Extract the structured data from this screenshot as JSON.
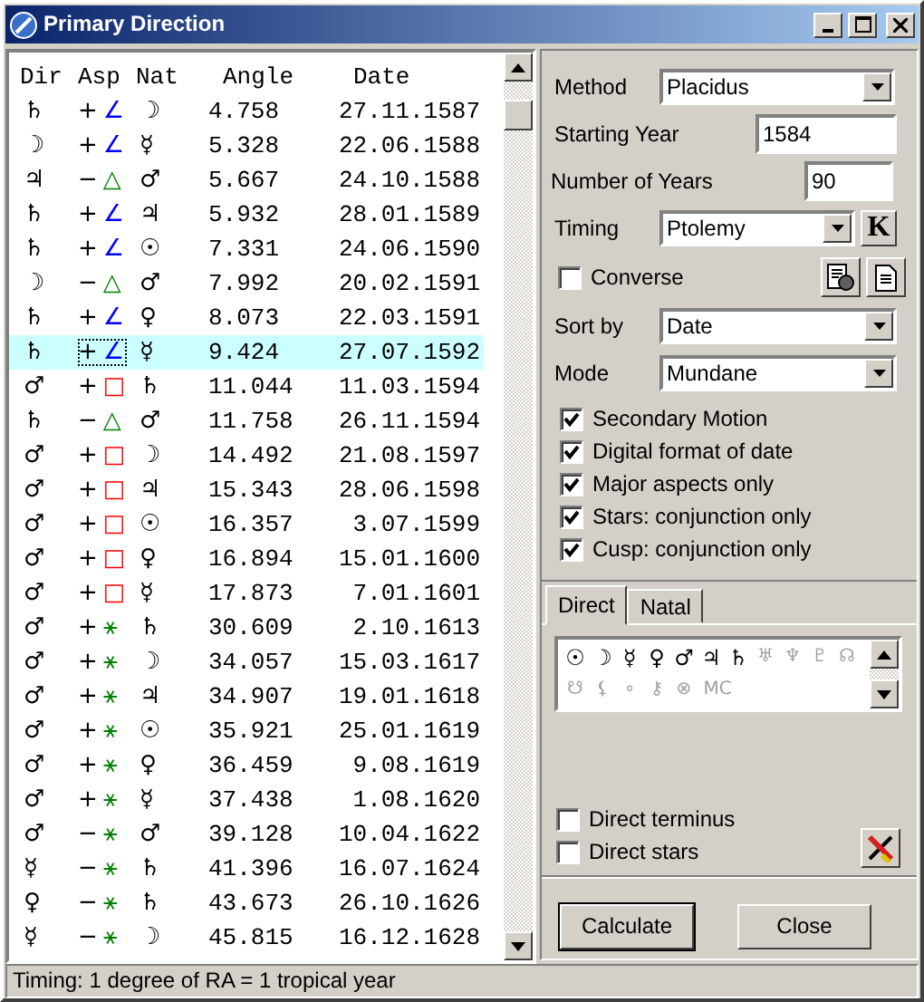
{
  "window": {
    "title": "Primary Direction"
  },
  "table": {
    "columns": [
      "Dir",
      "Asp",
      "Nat",
      "Angle",
      "Date"
    ],
    "rows": [
      {
        "dir": "♄",
        "sign": "+",
        "aspect": {
          "symbol": "∠",
          "color": "#0000ff"
        },
        "nat": "☽",
        "angle": "4.758",
        "date": "27.11.1587",
        "selected": false
      },
      {
        "dir": "☽",
        "sign": "+",
        "aspect": {
          "symbol": "∠",
          "color": "#0000ff"
        },
        "nat": "☿",
        "angle": "5.328",
        "date": "22.06.1588",
        "selected": false
      },
      {
        "dir": "♃",
        "sign": "−",
        "aspect": {
          "symbol": "△",
          "color": "#008000"
        },
        "nat": "♂",
        "angle": "5.667",
        "date": "24.10.1588",
        "selected": false
      },
      {
        "dir": "♄",
        "sign": "+",
        "aspect": {
          "symbol": "∠",
          "color": "#0000ff"
        },
        "nat": "♃",
        "angle": "5.932",
        "date": "28.01.1589",
        "selected": false
      },
      {
        "dir": "♄",
        "sign": "+",
        "aspect": {
          "symbol": "∠",
          "color": "#0000ff"
        },
        "nat": "☉",
        "angle": "7.331",
        "date": "24.06.1590",
        "selected": false
      },
      {
        "dir": "☽",
        "sign": "−",
        "aspect": {
          "symbol": "△",
          "color": "#008000"
        },
        "nat": "♂",
        "angle": "7.992",
        "date": "20.02.1591",
        "selected": false
      },
      {
        "dir": "♄",
        "sign": "+",
        "aspect": {
          "symbol": "∠",
          "color": "#0000ff"
        },
        "nat": "♀",
        "angle": "8.073",
        "date": "22.03.1591",
        "selected": false
      },
      {
        "dir": "♄",
        "sign": "+",
        "aspect": {
          "symbol": "∠",
          "color": "#0000ff"
        },
        "nat": "☿",
        "angle": "9.424",
        "date": "27.07.1592",
        "selected": true
      },
      {
        "dir": "♂",
        "sign": "+",
        "aspect": {
          "symbol": "□",
          "color": "#ff0000"
        },
        "nat": "♄",
        "angle": "11.044",
        "date": "11.03.1594",
        "selected": false
      },
      {
        "dir": "♄",
        "sign": "−",
        "aspect": {
          "symbol": "△",
          "color": "#008000"
        },
        "nat": "♂",
        "angle": "11.758",
        "date": "26.11.1594",
        "selected": false
      },
      {
        "dir": "♂",
        "sign": "+",
        "aspect": {
          "symbol": "□",
          "color": "#ff0000"
        },
        "nat": "☽",
        "angle": "14.492",
        "date": "21.08.1597",
        "selected": false
      },
      {
        "dir": "♂",
        "sign": "+",
        "aspect": {
          "symbol": "□",
          "color": "#ff0000"
        },
        "nat": "♃",
        "angle": "15.343",
        "date": "28.06.1598",
        "selected": false
      },
      {
        "dir": "♂",
        "sign": "+",
        "aspect": {
          "symbol": "□",
          "color": "#ff0000"
        },
        "nat": "☉",
        "angle": "16.357",
        "date": "3.07.1599",
        "selected": false
      },
      {
        "dir": "♂",
        "sign": "+",
        "aspect": {
          "symbol": "□",
          "color": "#ff0000"
        },
        "nat": "♀",
        "angle": "16.894",
        "date": "15.01.1600",
        "selected": false
      },
      {
        "dir": "♂",
        "sign": "+",
        "aspect": {
          "symbol": "□",
          "color": "#ff0000"
        },
        "nat": "☿",
        "angle": "17.873",
        "date": "7.01.1601",
        "selected": false
      },
      {
        "dir": "♂",
        "sign": "+",
        "aspect": {
          "symbol": "⚹",
          "color": "#008000"
        },
        "nat": "♄",
        "angle": "30.609",
        "date": "2.10.1613",
        "selected": false
      },
      {
        "dir": "♂",
        "sign": "+",
        "aspect": {
          "symbol": "⚹",
          "color": "#008000"
        },
        "nat": "☽",
        "angle": "34.057",
        "date": "15.03.1617",
        "selected": false
      },
      {
        "dir": "♂",
        "sign": "+",
        "aspect": {
          "symbol": "⚹",
          "color": "#008000"
        },
        "nat": "♃",
        "angle": "34.907",
        "date": "19.01.1618",
        "selected": false
      },
      {
        "dir": "♂",
        "sign": "+",
        "aspect": {
          "symbol": "⚹",
          "color": "#008000"
        },
        "nat": "☉",
        "angle": "35.921",
        "date": "25.01.1619",
        "selected": false
      },
      {
        "dir": "♂",
        "sign": "+",
        "aspect": {
          "symbol": "⚹",
          "color": "#008000"
        },
        "nat": "♀",
        "angle": "36.459",
        "date": "9.08.1619",
        "selected": false
      },
      {
        "dir": "♂",
        "sign": "+",
        "aspect": {
          "symbol": "⚹",
          "color": "#008000"
        },
        "nat": "☿",
        "angle": "37.438",
        "date": "1.08.1620",
        "selected": false
      },
      {
        "dir": "♂",
        "sign": "−",
        "aspect": {
          "symbol": "⚹",
          "color": "#008000"
        },
        "nat": "♂",
        "angle": "39.128",
        "date": "10.04.1622",
        "selected": false
      },
      {
        "dir": "☿",
        "sign": "−",
        "aspect": {
          "symbol": "⚹",
          "color": "#008000"
        },
        "nat": "♄",
        "angle": "41.396",
        "date": "16.07.1624",
        "selected": false
      },
      {
        "dir": "♀",
        "sign": "−",
        "aspect": {
          "symbol": "⚹",
          "color": "#008000"
        },
        "nat": "♄",
        "angle": "43.673",
        "date": "26.10.1626",
        "selected": false
      },
      {
        "dir": "☿",
        "sign": "−",
        "aspect": {
          "symbol": "⚹",
          "color": "#008000"
        },
        "nat": "☽",
        "angle": "45.815",
        "date": "16.12.1628",
        "selected": false
      }
    ]
  },
  "settings": {
    "method": {
      "label": "Method",
      "value": "Placidus"
    },
    "starting_year": {
      "label": "Starting Year",
      "value": "1584"
    },
    "number_of_years": {
      "label": "Number of Years",
      "value": "90"
    },
    "timing": {
      "label": "Timing",
      "value": "Ptolemy",
      "button": "K"
    },
    "converse": {
      "label": "Converse",
      "checked": false
    },
    "sort_by": {
      "label": "Sort by",
      "value": "Date"
    },
    "mode": {
      "label": "Mode",
      "value": "Mundane"
    },
    "options": [
      {
        "label": "Secondary Motion",
        "checked": true
      },
      {
        "label": "Digital format of date",
        "checked": true
      },
      {
        "label": "Major aspects only",
        "checked": true
      },
      {
        "label": "Stars: conjunction only",
        "checked": true
      },
      {
        "label": "Cusp: conjunction only",
        "checked": true
      }
    ]
  },
  "tabs": [
    {
      "label": "Direct",
      "selected": true
    },
    {
      "label": "Natal",
      "selected": false
    }
  ],
  "points": [
    {
      "symbol": "☉",
      "active": true
    },
    {
      "symbol": "☽",
      "active": true
    },
    {
      "symbol": "☿",
      "active": true
    },
    {
      "symbol": "♀",
      "active": true
    },
    {
      "symbol": "♂",
      "active": true
    },
    {
      "symbol": "♃",
      "active": true
    },
    {
      "symbol": "♄",
      "active": true
    },
    {
      "symbol": "♅",
      "active": false
    },
    {
      "symbol": "♆",
      "active": false
    },
    {
      "symbol": "♇",
      "active": false
    },
    {
      "symbol": "☊",
      "active": false
    },
    {
      "symbol": "☋",
      "active": false
    },
    {
      "symbol": "⚸",
      "active": false
    },
    {
      "symbol": "∘",
      "active": false
    },
    {
      "symbol": "⚷",
      "active": false
    },
    {
      "symbol": "⊗",
      "active": false
    },
    {
      "symbol": "MC",
      "active": false
    }
  ],
  "direct_options": [
    {
      "label": "Direct terminus",
      "checked": false
    },
    {
      "label": "Direct stars",
      "checked": false
    }
  ],
  "buttons": [
    {
      "label": "Calculate",
      "default": true
    },
    {
      "label": "Close",
      "default": false
    }
  ],
  "status_bar": "Timing: 1 degree of RA = 1 tropical year"
}
